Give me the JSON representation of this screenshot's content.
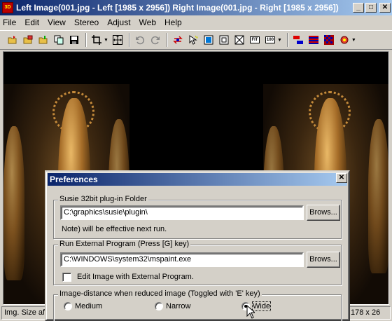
{
  "window": {
    "title": "Left Image(001.jpg - Left [1985 x 2956]) Right Image(001.jpg - Right [1985 x 2956])",
    "app_icon": "3D",
    "minimize": "_",
    "maximize": "□",
    "close": "✕"
  },
  "menu": [
    "File",
    "Edit",
    "View",
    "Stereo",
    "Adjust",
    "Web",
    "Help"
  ],
  "toolbar": {
    "icons": [
      "open-folder-icon",
      "open-pair-icon",
      "open-stereo-icon",
      "copy-icon",
      "save-icon",
      "crop-icon",
      "move-icon",
      "undo-icon",
      "redo-icon",
      "swap-icon",
      "select-icon",
      "fit-window-icon",
      "frame-icon",
      "full-icon",
      "fit-icon",
      "zoom-100-icon",
      "color-mode-icon",
      "lines-icon",
      "anaglyph-icon",
      "settings-icon"
    ],
    "fit_label": "FIT",
    "zoom_label": "100"
  },
  "status": {
    "left": "Img. Size after",
    "right": "178 x 26"
  },
  "dialog": {
    "title": "Preferences",
    "close": "✕",
    "susie": {
      "label": "Susie 32bit plug-in Folder",
      "value": "C:\\graphics\\susie\\plugin\\",
      "browse": "Brows...",
      "note": "Note) will be effective next run."
    },
    "external": {
      "label": "Run External Program (Press [G] key)",
      "value": "C:\\WINDOWS\\system32\\mspaint.exe",
      "browse": "Brows...",
      "checkbox_label": "Edit Image with External Program.",
      "checked": false
    },
    "distance": {
      "label": "Image-distance when reduced image (Toggled with 'E' key)",
      "options": [
        "Medium",
        "Narrow",
        "Wide"
      ],
      "selected": "Wide"
    }
  }
}
